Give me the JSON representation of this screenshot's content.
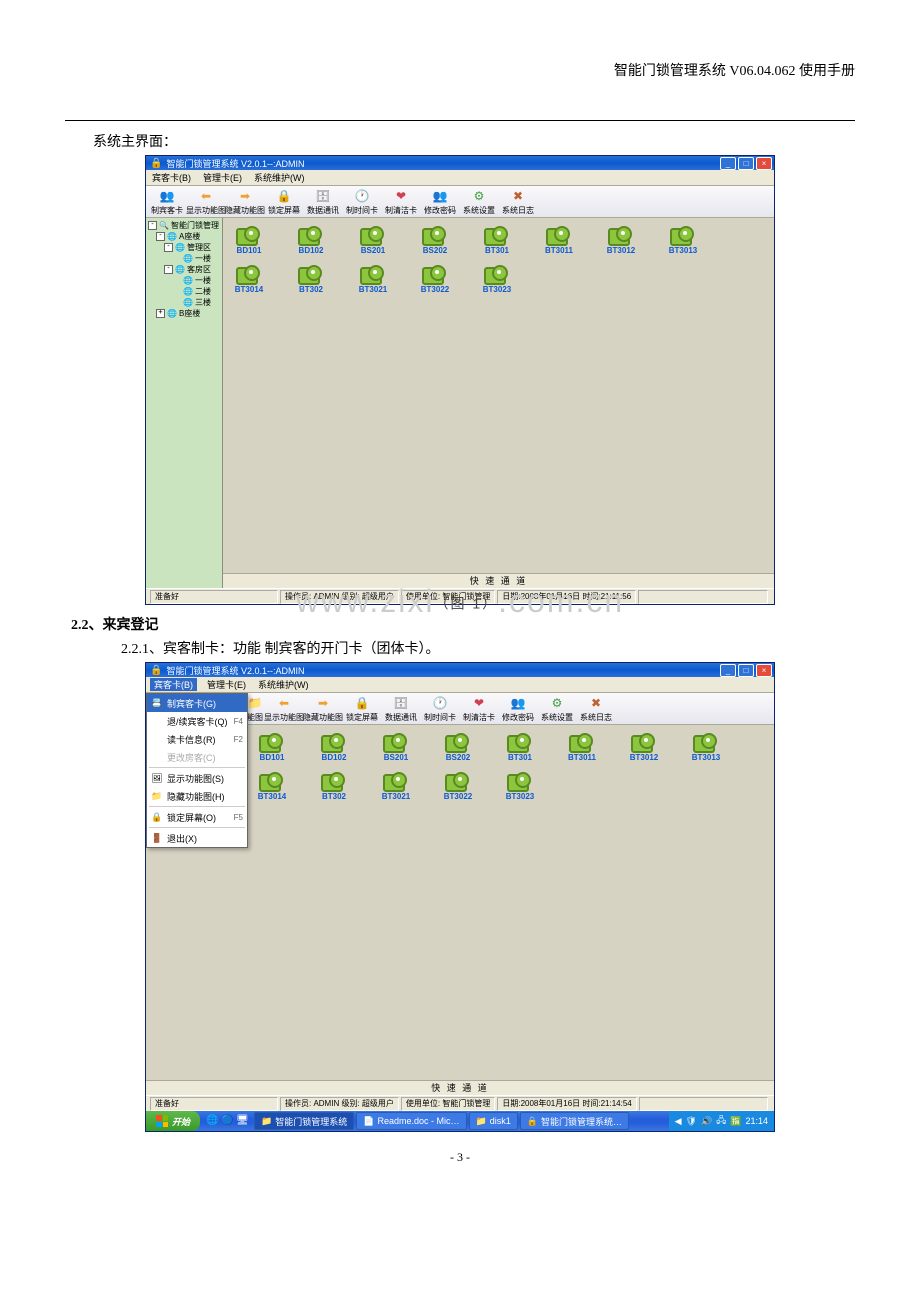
{
  "doc": {
    "header": "智能门锁管理系统 V06.04.062 使用手册",
    "intro_line": "系统主界面：",
    "fig1_caption": "（图 1）",
    "watermark": "www.zixi.com.cn",
    "section_2_2": "2.2、来宾登记",
    "section_2_2_1": "2.2.1、宾客制卡：功能 制宾客的开门卡（团体卡）。",
    "page_number": "- 3 -"
  },
  "app": {
    "title": "智能门锁管理系统  V2.0.1--:ADMIN",
    "menus": [
      {
        "label": "宾客卡(B)"
      },
      {
        "label": "管理卡(E)"
      },
      {
        "label": "系统维护(W)"
      }
    ],
    "toolbar": [
      {
        "name": "make-guest-card",
        "icon": "👥",
        "color": "#d08020",
        "label": "制宾客卡"
      },
      {
        "name": "show-func-map",
        "icon": "⬅",
        "color": "#f0a030",
        "label": "显示功能图"
      },
      {
        "name": "hide-func-map",
        "icon": "➡",
        "color": "#f0a030",
        "label": "隐藏功能图"
      },
      {
        "name": "lock-screen",
        "icon": "🔒",
        "color": "#d04040",
        "label": "锁定屏幕"
      },
      {
        "name": "data-comm",
        "icon": "🗄",
        "color": "#808080",
        "label": "数据通讯"
      },
      {
        "name": "make-time-card",
        "icon": "🕐",
        "color": "#409040",
        "label": "制时间卡"
      },
      {
        "name": "make-clean-card",
        "icon": "❤",
        "color": "#d04050",
        "label": "制清洁卡"
      },
      {
        "name": "change-password",
        "icon": "👥",
        "color": "#4060c0",
        "label": "修改密码"
      },
      {
        "name": "system-settings",
        "icon": "⚙",
        "color": "#40a040",
        "label": "系统设置"
      },
      {
        "name": "system-log",
        "icon": "✖",
        "color": "#c06030",
        "label": "系统日志"
      }
    ],
    "tree": [
      {
        "lvl": 1,
        "tog": "-",
        "icon": "🔍",
        "label": "智能门锁管理"
      },
      {
        "lvl": 2,
        "tog": "-",
        "icon": "🌐",
        "label": "A座楼"
      },
      {
        "lvl": 3,
        "tog": "-",
        "icon": "🌐",
        "label": "管理区"
      },
      {
        "lvl": 4,
        "tog": "",
        "icon": "🌐",
        "label": "一楼"
      },
      {
        "lvl": 3,
        "tog": "-",
        "icon": "🌐",
        "label": "客房区"
      },
      {
        "lvl": 4,
        "tog": "",
        "icon": "🌐",
        "label": "一楼"
      },
      {
        "lvl": 4,
        "tog": "",
        "icon": "🌐",
        "label": "二楼"
      },
      {
        "lvl": 4,
        "tog": "",
        "icon": "🌐",
        "label": "三楼"
      },
      {
        "lvl": 2,
        "tog": "+",
        "icon": "🌐",
        "label": "B座楼"
      }
    ],
    "rooms_row1": [
      "BD101",
      "BD102",
      "BS201",
      "BS202",
      "BT301",
      "BT3011",
      "BT3012",
      "BT3013"
    ],
    "rooms_row2": [
      "BT3014",
      "BT302",
      "BT3021",
      "BT3022",
      "BT3023"
    ],
    "quick_channel": "快 速 通 道",
    "status": {
      "ready": "准备好",
      "operator": "操作员: ADMIN 级别: 超级用户",
      "unit": "使用单位: 智能门锁管理",
      "datetime1": "日期:2008年01月16日 时间:21:11:56",
      "datetime2": "日期:2008年01月16日 时间:21:14:54"
    }
  },
  "dropdown": {
    "items": [
      {
        "icon": "📇",
        "label": "制宾客卡(G)",
        "shortcut": "",
        "highlight": true
      },
      {
        "icon": "",
        "label": "退/续宾客卡(Q)",
        "shortcut": "F4"
      },
      {
        "icon": "",
        "label": "读卡信息(R)",
        "shortcut": "F2"
      },
      {
        "icon": "",
        "label": "更改房客(C)",
        "shortcut": "",
        "disabled": true
      },
      {
        "sep": true
      },
      {
        "icon": "🖼",
        "label": "显示功能图(S)",
        "shortcut": ""
      },
      {
        "icon": "📁",
        "label": "隐藏功能图(H)",
        "shortcut": ""
      },
      {
        "sep": true
      },
      {
        "icon": "🔒",
        "label": "锁定屏幕(O)",
        "shortcut": "F5"
      },
      {
        "sep": true
      },
      {
        "icon": "🚪",
        "label": "退出(X)",
        "shortcut": ""
      }
    ]
  },
  "taskbar": {
    "start": "开始",
    "items": [
      {
        "icon": "📁",
        "label": "智能门锁管理系统",
        "active": true
      },
      {
        "icon": "📄",
        "label": "Readme.doc - Mic…"
      },
      {
        "icon": "📁",
        "label": "disk1"
      },
      {
        "icon": "🔒",
        "label": "智能门锁管理系统…"
      }
    ],
    "clock": "21:14"
  }
}
